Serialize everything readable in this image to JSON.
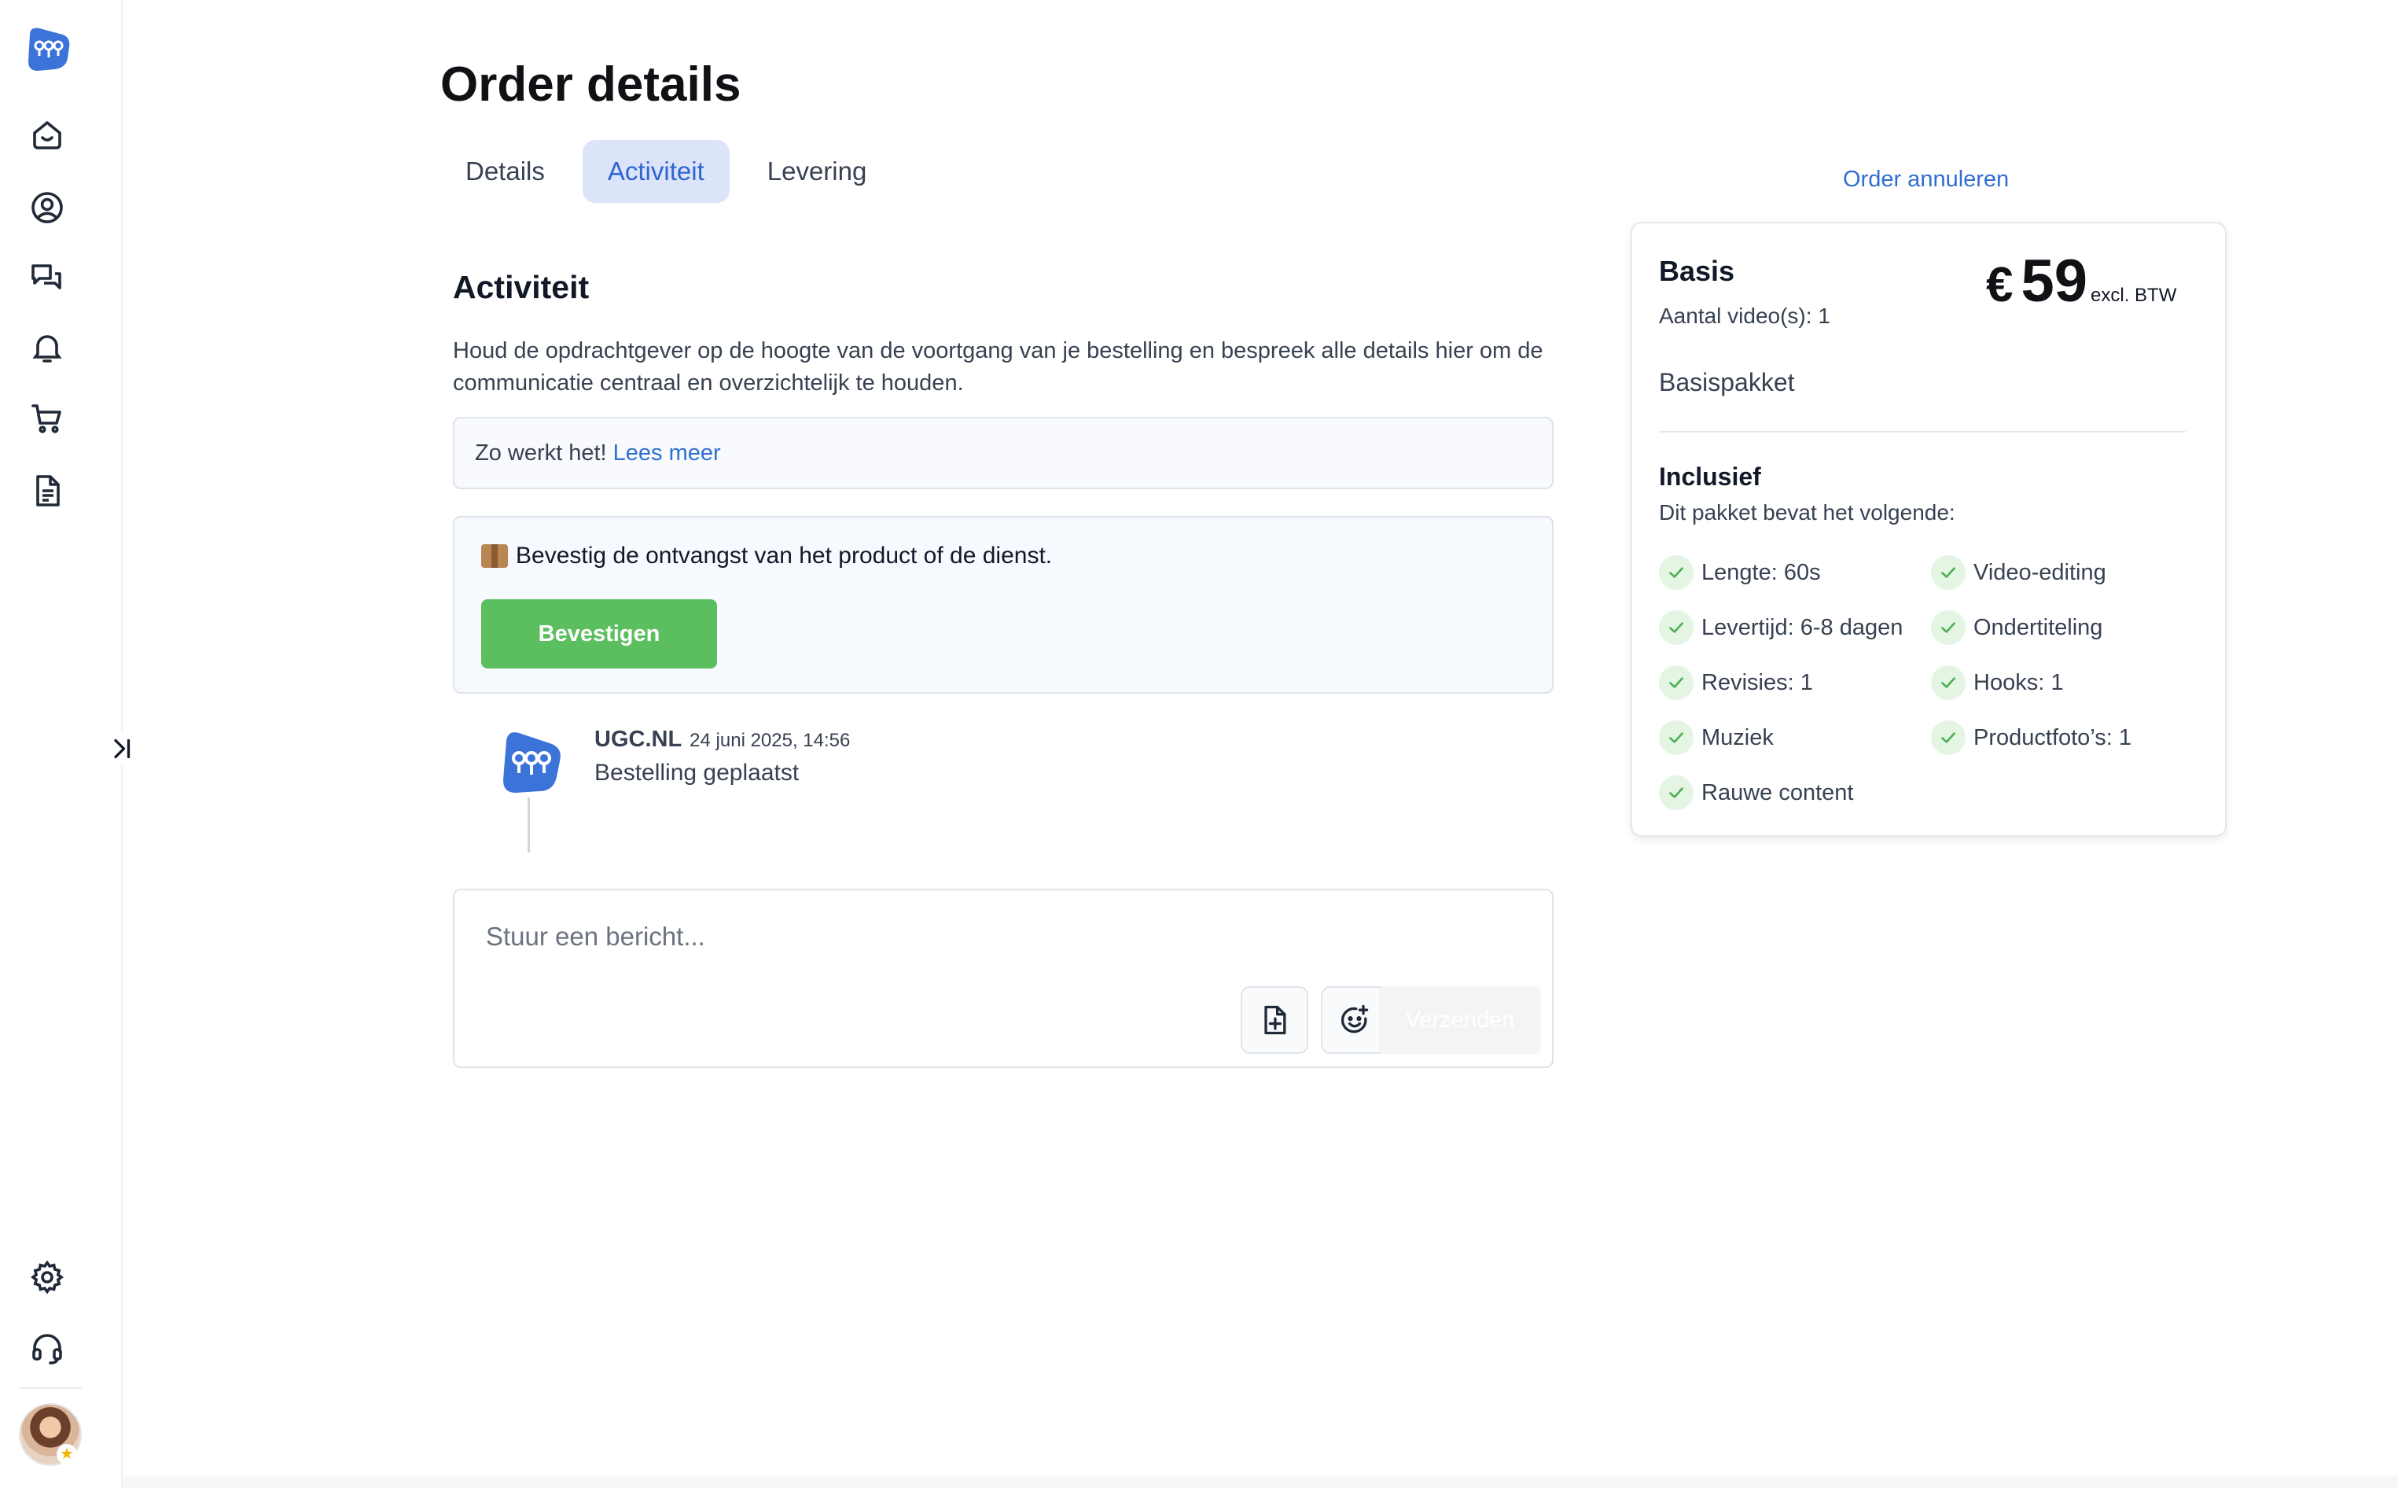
{
  "page": {
    "title": "Order details",
    "tabs": [
      {
        "label": "Details",
        "active": false
      },
      {
        "label": "Activiteit",
        "active": true
      },
      {
        "label": "Levering",
        "active": false
      }
    ]
  },
  "sidebar": {
    "icons": [
      "home-icon",
      "user-circle-icon",
      "chat-icon",
      "bell-icon",
      "cart-icon",
      "document-icon",
      "settings-icon",
      "headset-icon"
    ],
    "collapse_icon": "collapse-arrow-icon"
  },
  "activity": {
    "title": "Activiteit",
    "description": "Houd de opdrachtgever op de hoogte van de voortgang van je bestelling en bespreek alle details hier om de communicatie centraal en overzichtelijk te houden.",
    "howto_text": "Zo werkt het!",
    "howto_link": "Lees meer",
    "confirm_text": "Bevestig de ontvangst van het product of de dienst.",
    "confirm_button": "Bevestigen",
    "timeline": [
      {
        "author": "UGC.NL",
        "time": "24 juni 2025, 14:56",
        "message": "Bestelling geplaatst"
      }
    ],
    "message_placeholder": "Stuur een bericht...",
    "send_button": "Verzenden"
  },
  "package": {
    "cancel_link": "Order annuleren",
    "name": "Basis",
    "videos": "Aantal video(s): 1",
    "currency": "€",
    "price": "59",
    "vat": "excl. BTW",
    "description": "Basispakket",
    "included_title": "Inclusief",
    "included_sub": "Dit pakket bevat het volgende:",
    "features_left": [
      "Lengte: 60s",
      "Levertijd: 6-8 dagen",
      "Revisies: 1",
      "Muziek",
      "Rauwe content"
    ],
    "features_right": [
      "Video-editing",
      "Ondertiteling",
      "Hooks: 1",
      "Productfoto’s: 1"
    ]
  },
  "colors": {
    "accent": "#2f66d0",
    "tab_active_bg": "#dbe4f9",
    "confirm_green": "#5cbf5f",
    "check_bg": "#e4f5e4",
    "check_color": "#4caf50"
  }
}
